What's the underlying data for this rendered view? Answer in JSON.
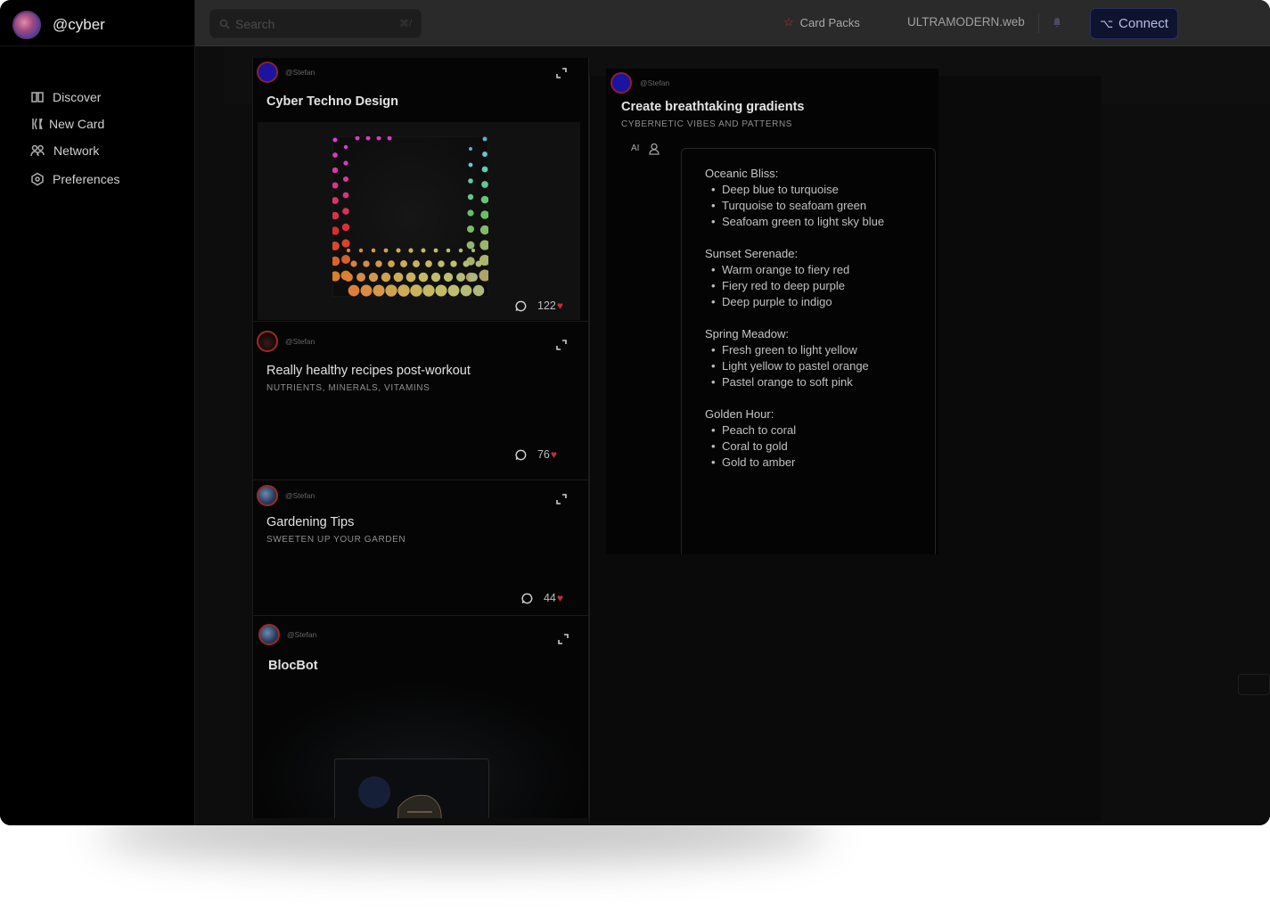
{
  "brand": {
    "name": "@cyber"
  },
  "sidebar": {
    "items": [
      {
        "label": "Discover",
        "icon": "book-open-icon"
      },
      {
        "label": "New Card",
        "icon": "sparkles-icon"
      },
      {
        "label": "Network",
        "icon": "users-icon"
      },
      {
        "label": "Preferences",
        "icon": "hexagon-gear-icon"
      }
    ]
  },
  "header": {
    "search_placeholder": "Search",
    "search_shortcut": "⌘/",
    "card_packs": "Card Packs",
    "site": "ULTRAMODERN.web",
    "connect": "Connect",
    "connect_symbol": "⌥"
  },
  "feed": {
    "cards": [
      {
        "author": "@Stefan",
        "title": "Cyber Techno Design",
        "subtitle": "",
        "likes": "122"
      },
      {
        "author": "@Stefan",
        "title": "Really healthy recipes post-workout",
        "subtitle": "NUTRIENTS, MINERALS, VITAMINS",
        "likes": "76"
      },
      {
        "author": "@Stefan",
        "title": "Gardening Tips",
        "subtitle": "SWEETEN UP YOUR GARDEN",
        "likes": "44"
      },
      {
        "author": "@Stefan",
        "title": "BlocBot",
        "subtitle": ""
      }
    ]
  },
  "detail": {
    "author": "@Stefan",
    "title": "Create breathtaking gradients",
    "subtitle": "CYBERNETIC VIBES AND PATTERNS",
    "ai_label": "AI",
    "groups": [
      {
        "title": "Oceanic Bliss:",
        "items": [
          "Deep blue to turquoise",
          "Turquoise to seafoam green",
          "Seafoam green to light sky blue"
        ]
      },
      {
        "title": "Sunset Serenade:",
        "items": [
          "Warm orange to fiery red",
          "Fiery red to deep purple",
          "Deep purple to indigo"
        ]
      },
      {
        "title": "Spring Meadow:",
        "items": [
          "Fresh green to light yellow",
          "Light yellow to pastel orange",
          "Pastel orange to soft pink"
        ]
      },
      {
        "title": "Golden Hour:",
        "items": [
          "Peach to coral",
          "Coral to gold",
          "Gold to amber"
        ]
      }
    ]
  },
  "colors": {
    "accent_heart": "#c22d3e",
    "connect_bg": "#0e1430",
    "star": "#c2303f"
  }
}
